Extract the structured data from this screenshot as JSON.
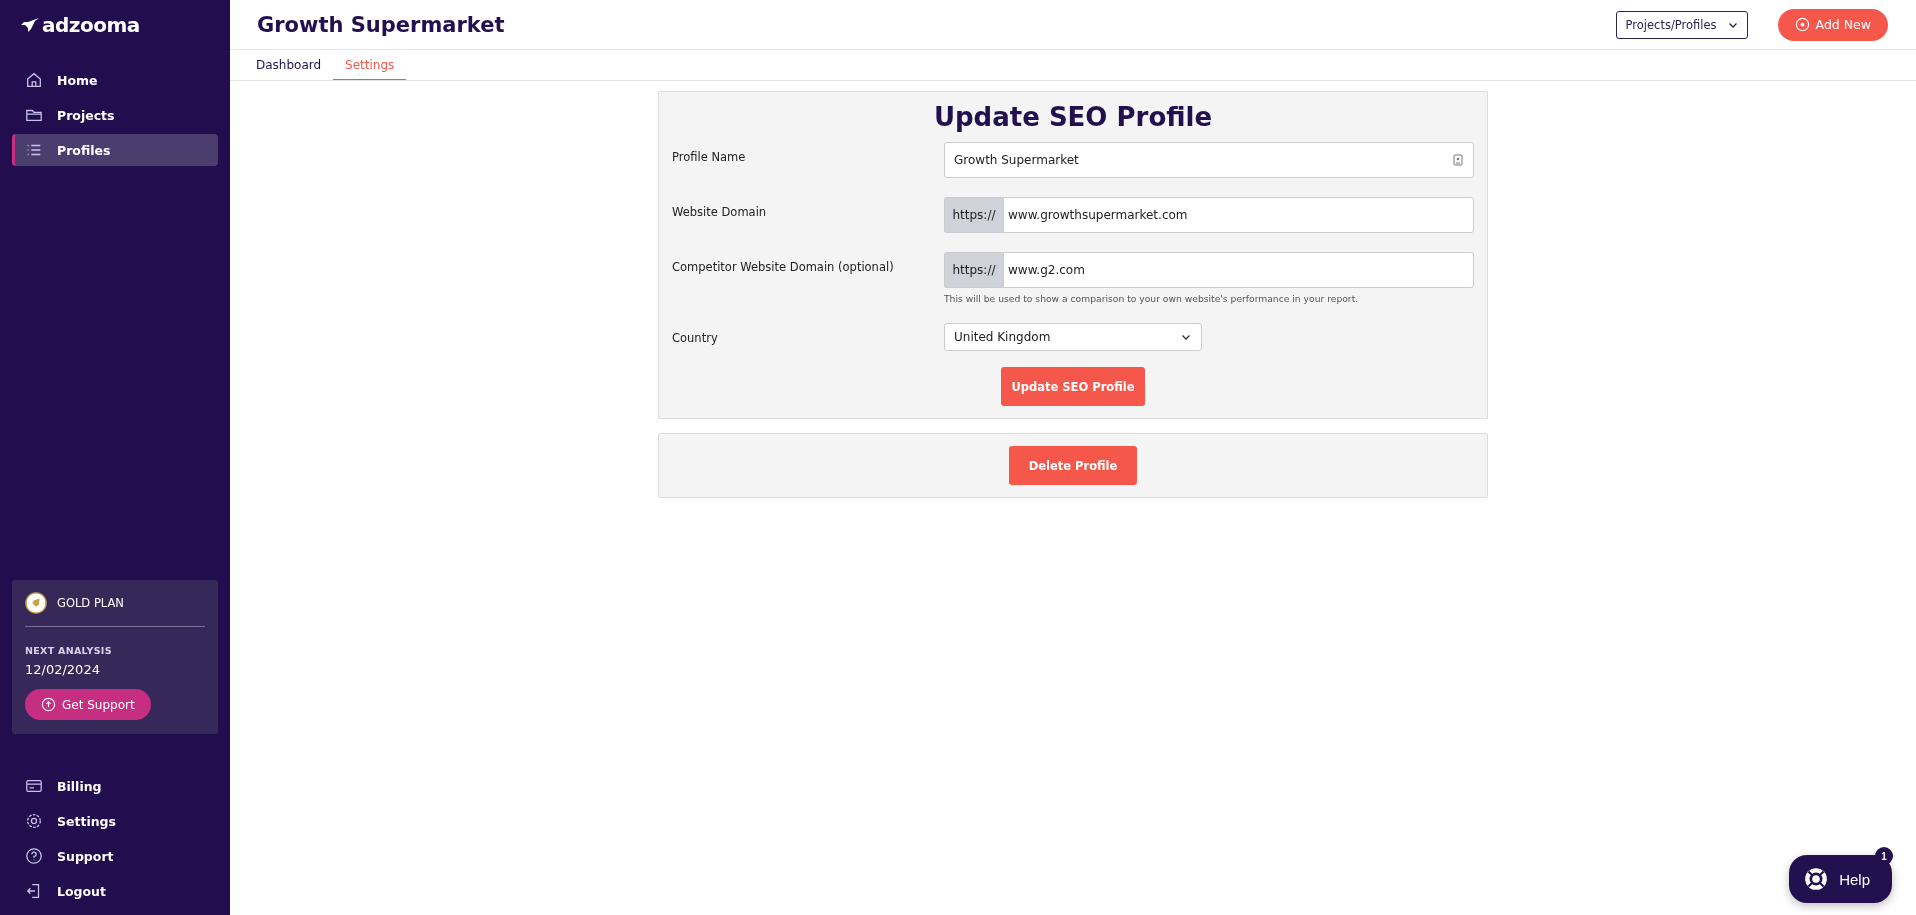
{
  "sidebar": {
    "logo": "adzooma",
    "items": [
      {
        "label": "Home",
        "selected": false
      },
      {
        "label": "Projects",
        "selected": false
      },
      {
        "label": "Profiles",
        "selected": true
      }
    ],
    "plan": {
      "name": "GOLD PLAN",
      "next_label": "NEXT ANALYSIS",
      "next_date": "12/02/2024",
      "button": "Get Support"
    },
    "bottom_items": [
      {
        "label": "Billing"
      },
      {
        "label": "Settings"
      },
      {
        "label": "Support"
      },
      {
        "label": "Logout"
      }
    ]
  },
  "header": {
    "title": "Growth Supermarket",
    "dropdown": "Projects/Profiles",
    "add_button": "Add New"
  },
  "tabs": [
    {
      "label": "Dashboard",
      "selected": false
    },
    {
      "label": "Settings",
      "selected": true
    }
  ],
  "form": {
    "title": "Update SEO Profile",
    "fields": [
      {
        "kind": "text",
        "label": "Profile Name",
        "value": "Growth Supermarket"
      },
      {
        "kind": "prefixed",
        "label": "Website Domain",
        "prefix": "https://",
        "value": "www.growthsupermarket.com"
      },
      {
        "kind": "prefixed",
        "label": "Competitor Website Domain (optional)",
        "prefix": "https://",
        "value": "www.g2.com",
        "help": "This will be used to show a comparison to your own website's performance in your report."
      },
      {
        "kind": "select",
        "label": "Country",
        "value": "United Kingdom"
      }
    ],
    "submit": "Update SEO Profile"
  },
  "delete_button": "Delete Profile",
  "help_widget": {
    "label": "Help",
    "badge": "1"
  }
}
